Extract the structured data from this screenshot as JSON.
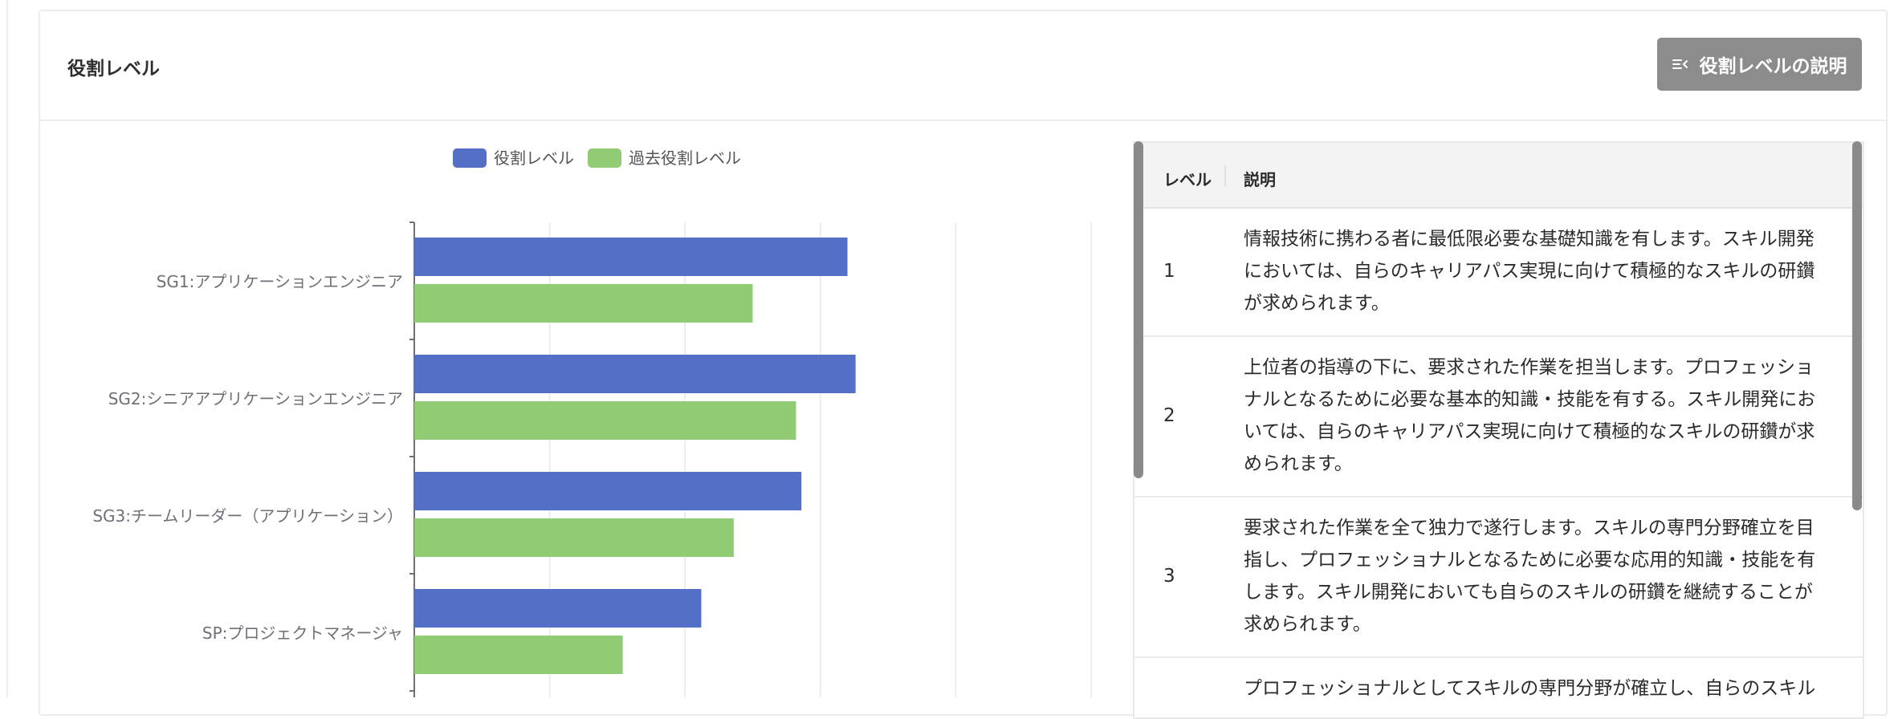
{
  "card": {
    "title": "役割レベル",
    "explain_button_label": "役割レベルの説明",
    "explain_button_icon": "list-collapse-icon"
  },
  "colors": {
    "current": "#5470c6",
    "past": "#91cc75",
    "button_bg": "#8c8c8c"
  },
  "chart_data": {
    "type": "bar",
    "orientation": "horizontal",
    "categories": [
      "SG1:アプリケーションエンジニア",
      "SG2:シニアアプリケーションエンジニア",
      "SG3:チームリーダー（アプリケーション）",
      "SP:プロジェクトマネージャ"
    ],
    "series": [
      {
        "name": "役割レベル",
        "values": [
          3.2,
          3.26,
          2.86,
          2.12
        ]
      },
      {
        "name": "過去役割レベル",
        "values": [
          2.5,
          2.82,
          2.36,
          1.54
        ]
      }
    ],
    "xlim": [
      0,
      5
    ],
    "grid": true,
    "legend": "top-center"
  },
  "table": {
    "headers": {
      "level": "レベル",
      "description": "説明"
    },
    "rows": [
      {
        "level": "1",
        "lines": [
          "情報技術に携わる者に最低限必要な基礎知識を有します。スキル開発",
          "においては、自らのキャリアパス実現に向けて積極的なスキルの研鑽",
          "が求められます。"
        ]
      },
      {
        "level": "2",
        "lines": [
          "上位者の指導の下に、要求された作業を担当します。プロフェッショ",
          "ナルとなるために必要な基本的知識・技能を有する。スキル開発にお",
          "いては、自らのキャリアパス実現に向けて積極的なスキルの研鑽が求",
          "められます。"
        ]
      },
      {
        "level": "3",
        "lines": [
          "要求された作業を全て独力で遂行します。スキルの専門分野確立を目",
          "指し、プロフェッショナルとなるために必要な応用的知識・技能を有",
          "します。スキル開発においても自らのスキルの研鑽を継続することが",
          "求められます。"
        ]
      },
      {
        "level": "",
        "lines": [
          "プロフェッショナルとしてスキルの専門分野が確立し、自らのスキル"
        ]
      }
    ]
  }
}
